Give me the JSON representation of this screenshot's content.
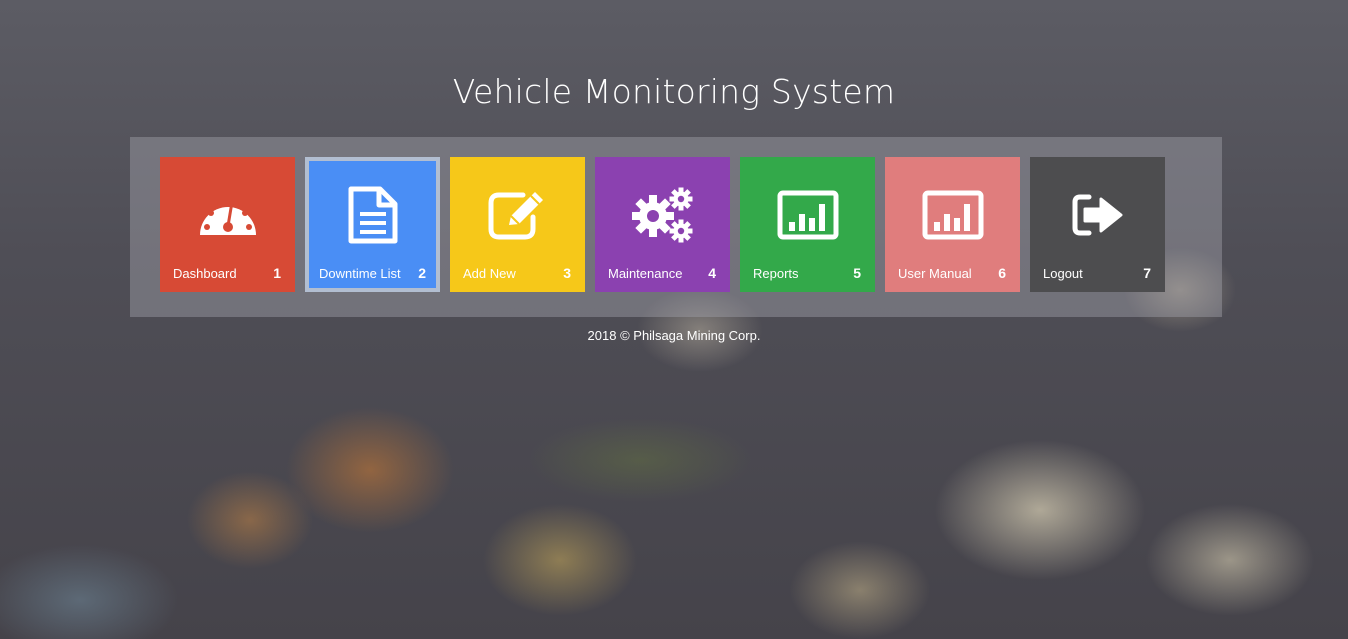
{
  "header": {
    "title": "Vehicle Monitoring System"
  },
  "tiles": [
    {
      "label": "Dashboard",
      "number": "1",
      "icon": "tachometer-icon",
      "color": "#d74a35"
    },
    {
      "label": "Downtime List",
      "number": "2",
      "icon": "document-icon",
      "color": "#4a8ef5"
    },
    {
      "label": "Add New",
      "number": "3",
      "icon": "edit-icon",
      "color": "#f6c819"
    },
    {
      "label": "Maintenance",
      "number": "4",
      "icon": "gears-icon",
      "color": "#8b41b0"
    },
    {
      "label": "Reports",
      "number": "5",
      "icon": "bar-chart-icon",
      "color": "#33a94a"
    },
    {
      "label": "User Manual",
      "number": "6",
      "icon": "bar-chart-icon",
      "color": "#e07d7d"
    },
    {
      "label": "Logout",
      "number": "7",
      "icon": "sign-out-icon",
      "color": "#4d4d4f"
    }
  ],
  "selected_tile": "Downtime List",
  "footer": {
    "text": "2018 © Philsaga Mining Corp."
  }
}
